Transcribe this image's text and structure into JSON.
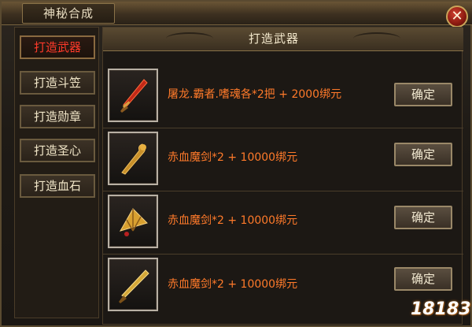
{
  "window": {
    "title": "神秘合成"
  },
  "close_label": "✕",
  "sidebar": {
    "items": [
      {
        "label": "打造武器",
        "active": true
      },
      {
        "label": "打造斗笠",
        "active": false
      },
      {
        "label": "打造勋章",
        "active": false
      },
      {
        "label": "打造圣心",
        "active": false
      },
      {
        "label": "打造血石",
        "active": false
      }
    ]
  },
  "panel": {
    "title": "打造武器",
    "recipes": [
      {
        "item_icon": "red-blade-icon",
        "text": "屠龙.霸者.嗜魂各*2把 + 2000绑元",
        "button": "确定"
      },
      {
        "item_icon": "golden-staff-icon",
        "text": "赤血魔剑*2 + 10000绑元",
        "button": "确定"
      },
      {
        "item_icon": "golden-fan-icon",
        "text": "赤血魔剑*2 + 10000绑元",
        "button": "确定"
      },
      {
        "item_icon": "golden-sword-icon",
        "text": "赤血魔剑*2 + 10000绑元",
        "button": "确定"
      }
    ]
  },
  "watermark": {
    "text": "18183"
  },
  "colors": {
    "active_tab_text": "#ff3a2a",
    "recipe_text": "#ff7a2a",
    "button_text": "#f1e8d0"
  }
}
